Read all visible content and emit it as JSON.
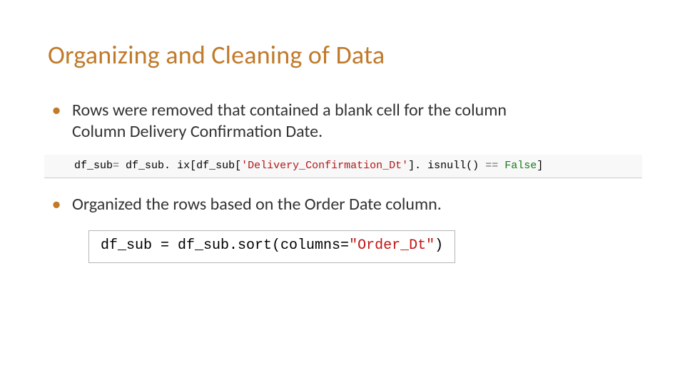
{
  "title": "Organizing and Cleaning of Data",
  "bullets": {
    "b1_line1": "Rows were removed that contained a blank cell for the column",
    "b1_line2": "Column Delivery Confirmation Date.",
    "b2": "Organized the rows based on the Order Date column."
  },
  "code1": {
    "seg1": "df_sub",
    "seg_eq1": "=",
    "seg2": " df_sub",
    "seg_dot": ".",
    "seg3": " ix[df_sub[",
    "seg_str": "'Delivery_Confirmation_Dt'",
    "seg4": "]",
    "seg_dot2": ".",
    "seg5": " isnull() ",
    "seg_eq2": "==",
    "seg_sp": " ",
    "seg_bool": "False",
    "seg_end": "]"
  },
  "code2": {
    "seg1": "df_sub = df_sub.sort(columns=",
    "seg_str": "\"Order_Dt\"",
    "seg_end": ")"
  }
}
